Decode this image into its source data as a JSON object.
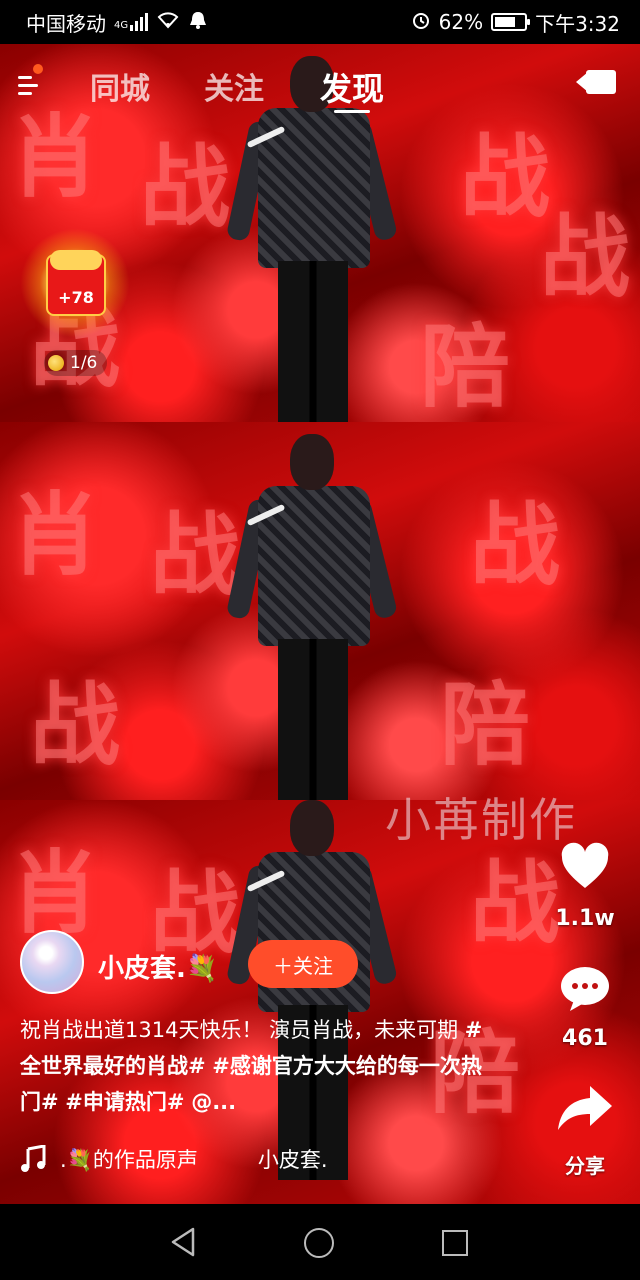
{
  "status_bar": {
    "carrier": "中国移动",
    "network": "4G",
    "battery_percent": "62%",
    "time": "下午3:32",
    "icons": [
      "signal-icon",
      "wifi-icon",
      "notification-icon",
      "alarm-icon",
      "battery-icon"
    ]
  },
  "top_nav": {
    "tabs": [
      {
        "label": "同城",
        "active": false
      },
      {
        "label": "关注",
        "active": false
      },
      {
        "label": "发现",
        "active": true
      }
    ],
    "icons": [
      "menu-icon",
      "camera-icon"
    ]
  },
  "video": {
    "watermark": "小苒制作"
  },
  "red_packet": {
    "amount": "+78",
    "progress": "1/6"
  },
  "actions": {
    "likes": "1.1w",
    "comments": "461",
    "share_label": "分享"
  },
  "author": {
    "name": "小皮套.💐",
    "follow_label": "＋关注"
  },
  "caption": {
    "text": "祝肖战出道1314天快乐！ 演员肖战，未来可期 ",
    "tags": [
      "#全世界最好的肖战#",
      "#感谢官方大大给的每一次热门#",
      "#申请热门#"
    ],
    "mention": "@..."
  },
  "music": {
    "name": ".💐的作品原声",
    "author": "小皮套."
  },
  "colors": {
    "accent": "#ff4d2a",
    "menu_badge": "#ff5a1f"
  }
}
